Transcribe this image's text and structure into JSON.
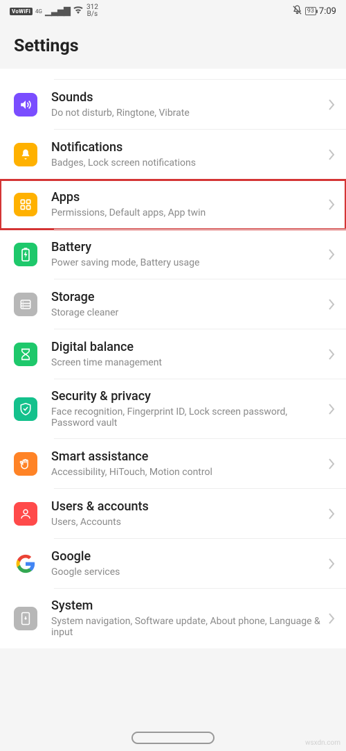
{
  "status": {
    "vowifi": "VoWiFi",
    "net_gen": "4G",
    "speed_top": "312",
    "speed_unit": "B/s",
    "battery_pct": "93",
    "clock": "7:09"
  },
  "header": {
    "title": "Settings"
  },
  "items": [
    {
      "icon": "sound-icon",
      "bg": "bg-purple",
      "title": "Sounds",
      "subtitle": "Do not disturb, Ringtone, Vibrate"
    },
    {
      "icon": "bell-icon",
      "bg": "bg-yellow",
      "title": "Notifications",
      "subtitle": "Badges, Lock screen notifications"
    },
    {
      "icon": "apps-icon",
      "bg": "bg-yellow",
      "title": "Apps",
      "subtitle": "Permissions, Default apps, App twin",
      "highlight": true
    },
    {
      "icon": "battery-icon",
      "bg": "bg-green",
      "title": "Battery",
      "subtitle": "Power saving mode, Battery usage"
    },
    {
      "icon": "storage-icon",
      "bg": "bg-gray",
      "title": "Storage",
      "subtitle": "Storage cleaner"
    },
    {
      "icon": "hourglass-icon",
      "bg": "bg-green",
      "title": "Digital balance",
      "subtitle": "Screen time management"
    },
    {
      "icon": "shield-icon",
      "bg": "bg-teal",
      "title": "Security & privacy",
      "subtitle": "Face recognition, Fingerprint ID, Lock screen password, Password vault"
    },
    {
      "icon": "hand-icon",
      "bg": "bg-orange",
      "title": "Smart assistance",
      "subtitle": "Accessibility, HiTouch, Motion control"
    },
    {
      "icon": "user-icon",
      "bg": "bg-red",
      "title": "Users & accounts",
      "subtitle": "Users, Accounts"
    },
    {
      "icon": "google-icon",
      "bg": "",
      "title": "Google",
      "subtitle": "Google services"
    },
    {
      "icon": "system-icon",
      "bg": "bg-gray",
      "title": "System",
      "subtitle": "System navigation, Software update, About phone, Language & input"
    }
  ],
  "watermark": "wsxdn.com"
}
